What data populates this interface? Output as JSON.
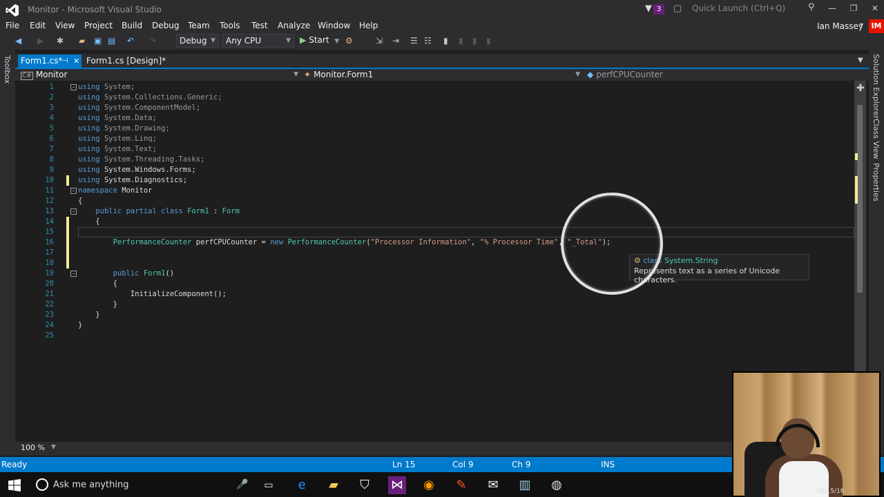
{
  "window": {
    "title": "Monitor - Microsoft Visual Studio",
    "notification_count": "3",
    "quick_launch_placeholder": "Quick Launch (Ctrl+Q)"
  },
  "menu": {
    "items": [
      "File",
      "Edit",
      "View",
      "Project",
      "Build",
      "Debug",
      "Team",
      "Tools",
      "Test",
      "Analyze",
      "Window",
      "Help"
    ],
    "user_name": "Ian Massey",
    "user_initials": "IM"
  },
  "toolbar": {
    "configuration": "Debug",
    "platform": "Any CPU",
    "start_label": "Start"
  },
  "side_tabs": {
    "left": "Toolbox",
    "right": [
      "Solution Explorer",
      "Class View",
      "Properties"
    ]
  },
  "tabs": [
    {
      "label": "Form1.cs*",
      "active": true
    },
    {
      "label": "Form1.cs [Design]*",
      "active": false
    }
  ],
  "navbar": {
    "project": "Monitor",
    "type": "Monitor.Form1",
    "member": "perfCPUCounter"
  },
  "code_lines": [
    {
      "n": "1",
      "text": "using System;"
    },
    {
      "n": "2",
      "text": "using System.Collections.Generic;"
    },
    {
      "n": "3",
      "text": "using System.ComponentModel;"
    },
    {
      "n": "4",
      "text": "using System.Data;"
    },
    {
      "n": "5",
      "text": "using System.Drawing;"
    },
    {
      "n": "6",
      "text": "using System.Linq;"
    },
    {
      "n": "7",
      "text": "using System.Text;"
    },
    {
      "n": "8",
      "text": "using System.Threading.Tasks;"
    },
    {
      "n": "9",
      "text": "using System.Windows.Forms;"
    },
    {
      "n": "10",
      "text": "using System.Diagnostics;"
    },
    {
      "n": "11",
      "text": "namespace Monitor"
    },
    {
      "n": "12",
      "text": "{"
    },
    {
      "n": "13",
      "text": "    public partial class Form1 : Form"
    },
    {
      "n": "14",
      "text": "    {"
    },
    {
      "n": "15",
      "text": ""
    },
    {
      "n": "16",
      "text": "        PerformanceCounter perfCPUCounter = new PerformanceCounter(\"Processor Information\", \"% Processor Time\", \"_Total\");"
    },
    {
      "n": "17",
      "text": ""
    },
    {
      "n": "18",
      "text": ""
    },
    {
      "n": "19",
      "text": "        public Form1()"
    },
    {
      "n": "20",
      "text": "        {"
    },
    {
      "n": "21",
      "text": "            InitializeComponent();"
    },
    {
      "n": "22",
      "text": "        }"
    },
    {
      "n": "23",
      "text": "    }"
    },
    {
      "n": "24",
      "text": "}"
    },
    {
      "n": "25",
      "text": ""
    }
  ],
  "tooltip": {
    "keyword": "class",
    "type": "System.String",
    "description": "Represents text as a series of Unicode characters."
  },
  "zoom": "100 %",
  "status": {
    "state": "Ready",
    "line": "Ln 15",
    "col": "Col 9",
    "ch": "Ch 9",
    "mode": "INS"
  },
  "taskbar": {
    "search_placeholder": "Ask me anything"
  },
  "webcam": {
    "timestamp": "08/15/16"
  },
  "colors": {
    "accent": "#007acc",
    "keyword": "#569cd6",
    "type": "#4ec9b0",
    "string": "#d69d85",
    "line_number": "#2b91af"
  }
}
